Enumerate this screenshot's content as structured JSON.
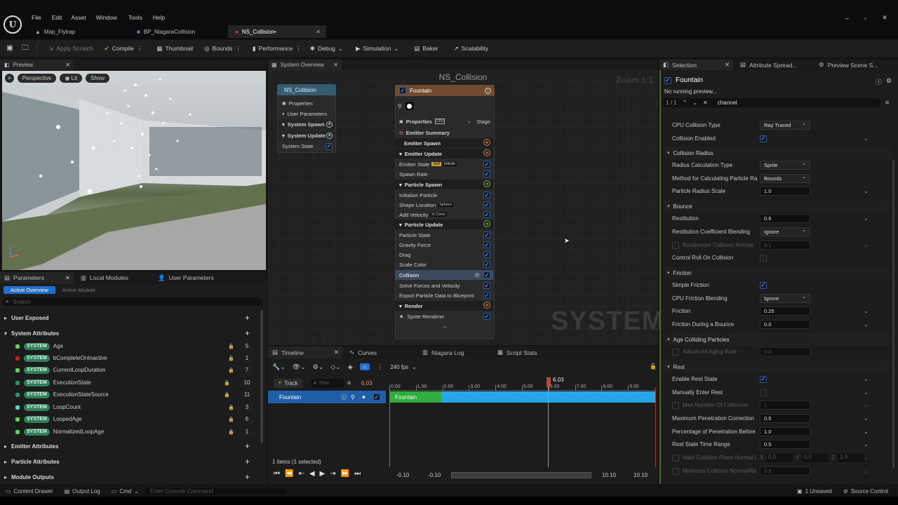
{
  "menu": [
    "File",
    "Edit",
    "Asset",
    "Window",
    "Tools",
    "Help"
  ],
  "doc_tabs": [
    {
      "label": "Map_Flytrap",
      "icon": "map-icon"
    },
    {
      "label": "BP_NiagaraCollision",
      "icon": "blueprint-icon"
    },
    {
      "label": "NS_Collision•",
      "icon": "niagara-icon"
    }
  ],
  "toolbar": {
    "apply_scratch": "Apply Scratch",
    "compile": "Compile",
    "thumbnail": "Thumbnail",
    "bounds": "Bounds",
    "performance": "Performance",
    "debug": "Debug",
    "simulation": "Simulation",
    "baker": "Baker",
    "scalability": "Scalability"
  },
  "preview": {
    "tab": "Preview",
    "perspective": "Perspective",
    "lit": "Lit",
    "show": "Show"
  },
  "params": {
    "tabs": [
      "Parameters",
      "Local Modules",
      "User Parameters"
    ],
    "subtabs": [
      "Active Overview",
      "Active Module"
    ],
    "search_placeholder": "Search",
    "user_exposed": "User Exposed",
    "system_attributes": "System Attributes",
    "badge": "SYSTEM",
    "attrs": [
      {
        "name": "Age",
        "count": "5",
        "color": "#5fd05f"
      },
      {
        "name": "bCompleteOnInactive",
        "count": "1",
        "color": "#c02020"
      },
      {
        "name": "CurrentLoopDuration",
        "count": "7",
        "color": "#5fd05f"
      },
      {
        "name": "ExecutionState",
        "count": "10",
        "color": "#2f8f6f"
      },
      {
        "name": "ExecutionStateSource",
        "count": "11",
        "color": "#2f8f6f"
      },
      {
        "name": "LoopCount",
        "count": "3",
        "color": "#5fd0d0"
      },
      {
        "name": "LoopedAge",
        "count": "6",
        "color": "#5fd05f"
      },
      {
        "name": "NormalizedLoopAge",
        "count": "1",
        "color": "#5fd05f"
      }
    ],
    "emitter_attributes": "Emitter Attributes",
    "particle_attributes": "Particle Attributes",
    "module_outputs": "Module Outputs"
  },
  "overview": {
    "tab": "System Overview",
    "title": "NS_Collision",
    "zoom": "Zoom 1:1",
    "watermark": "SYSTEM",
    "system_node": {
      "title": "NS_Collision",
      "rows": [
        "Properties",
        "User Parameters",
        "System Spawn",
        "System Update",
        "System State"
      ]
    },
    "emitter_node": {
      "title": "Fountain",
      "properties": "Properties",
      "stage": "Stage",
      "emitter_summary": "Emitter Summary",
      "emitter_spawn": "Emitter Spawn",
      "emitter_update": "Emitter Update",
      "emitter_state": "Emitter State",
      "emitter_state_tags": [
        "Self",
        "Infinite"
      ],
      "spawn_rate": "Spawn Rate",
      "particle_spawn": "Particle Spawn",
      "initialize_particle": "Initialize Particle",
      "shape_location": "Shape Location",
      "shape_tag": "Sphere",
      "add_velocity": "Add Velocity",
      "velocity_tag": "In Cone",
      "particle_update": "Particle Update",
      "particle_state": "Particle State",
      "gravity_force": "Gravity Force",
      "drag": "Drag",
      "scale_color": "Scale Color",
      "collision": "Collision",
      "solve_forces": "Solve Forces and Velocity",
      "export_particle": "Export Particle Data to Blueprint",
      "render": "Render",
      "sprite_renderer": "Sprite Renderer"
    }
  },
  "timeline": {
    "tabs": [
      "Timeline",
      "Curves",
      "Niagara Log",
      "Script Stats"
    ],
    "fps": "240 fps",
    "track_btn": "Track",
    "search_placeholder": "Sear",
    "time": "6.03",
    "playhead": "6.03",
    "track_name": "Fountain",
    "bar_label": "Fountain",
    "ticks": [
      "0.00",
      "1.00",
      "2.00",
      "3.00",
      "4.00",
      "5.00",
      "6.00",
      "7.00",
      "8.00",
      "9.00"
    ],
    "items_selected": "1 items (1 selected)",
    "range_left_a": "-0.10",
    "range_left_b": "-0.10",
    "range_right_a": "10.10",
    "range_right_b": "10.10"
  },
  "details": {
    "tabs": [
      "Selection",
      "Attribute Spread...",
      "Preview Scene S..."
    ],
    "title": "Fountain",
    "subtitle": "No running preview...",
    "counter": "1 / 1",
    "search_value": "channel",
    "cpu_collision_type": {
      "label": "CPU Collision Type",
      "value": "Ray Traced"
    },
    "collision_enabled": "Collision Enabled",
    "sec_collision_radius": "Collision Radius",
    "radius_calc": {
      "label": "Radius Calculation Type",
      "value": "Sprite"
    },
    "method_calc": {
      "label": "Method for Calculating Particle Ra",
      "value": "Bounds"
    },
    "radius_scale": {
      "label": "Particle Radius Scale",
      "value": "1.0"
    },
    "sec_bounce": "Bounce",
    "restitution": {
      "label": "Restitution",
      "value": "0.6"
    },
    "restitution_blend": {
      "label": "Restitution Coefficient Blending",
      "value": "Ignore"
    },
    "randomize_normal": {
      "label": "Randomize Collision Normal",
      "value": "0.1"
    },
    "control_roll": "Control Roll On Collision",
    "sec_friction": "Friction",
    "simple_friction": "Simple Friction",
    "cpu_friction_blend": {
      "label": "CPU Friction Blending",
      "value": "Ignore"
    },
    "friction": {
      "label": "Friction",
      "value": "0.25"
    },
    "friction_bounce": {
      "label": "Friction During a Bounce",
      "value": "0.0"
    },
    "sec_age": "Age Colliding Particles",
    "advanced_aging": {
      "label": "Advanced Aging Rate",
      "value": "0.0"
    },
    "sec_rest": "Rest",
    "enable_rest": "Enable Rest State",
    "manual_rest": "Manually Enter Rest",
    "max_collisions": {
      "label": "Max Number Of Collisions",
      "value": "1"
    },
    "max_penetration": {
      "label": "Maximum Penetration Correction",
      "value": "0.5"
    },
    "pct_penetration": {
      "label": "Percentage of Penetration Before",
      "value": "1.0"
    },
    "rest_time": {
      "label": "Rest State Time Range",
      "value": "0.5"
    },
    "valid_plane": {
      "label": "Valid Collision Plane Normal I",
      "x": "0.0",
      "y": "0.0",
      "z": "1.0"
    },
    "min_normal": {
      "label": "Minimum Collision Normal/Re",
      "value": "0.5"
    }
  },
  "statusbar": {
    "content_drawer": "Content Drawer",
    "output_log": "Output Log",
    "cmd": "Cmd",
    "console_placeholder": "Enter Console Command",
    "unsaved": "1 Unsaved",
    "source_control": "Source Control"
  }
}
